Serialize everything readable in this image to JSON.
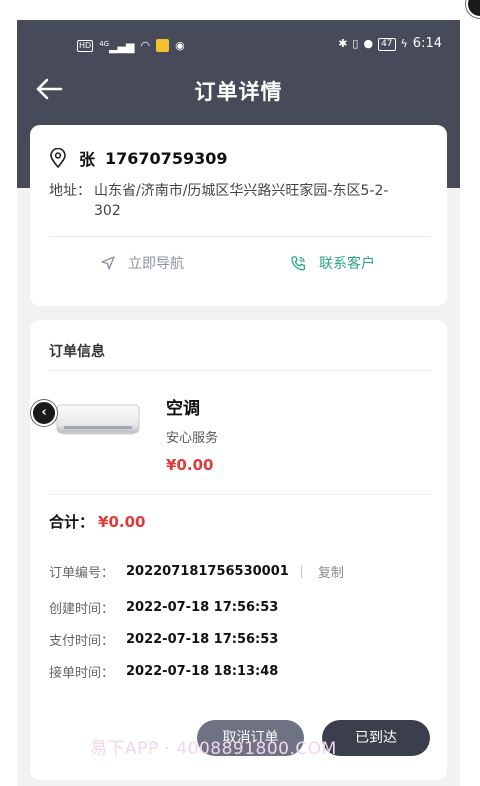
{
  "status_bar": {
    "left_icons": [
      "hd-icon",
      "signal-icon",
      "wifi-icon",
      "app-notification-icon",
      "location-share-icon"
    ],
    "hd_label": "HD",
    "network_label": "4G",
    "battery_level": "47",
    "time": "6:14"
  },
  "nav": {
    "title": "订单详情"
  },
  "address_card": {
    "contact_name": "张",
    "contact_phone": "17670759309",
    "address_label": "地址：",
    "address_text": "山东省/济南市/历城区华兴路兴旺家园-东区5-2-302",
    "navigate_label": "立即导航",
    "contact_label": "联系客户",
    "colors": {
      "navigate": "#8c93a6",
      "contact": "#2ea58b"
    }
  },
  "order_card": {
    "section_title": "订单信息",
    "product": {
      "name": "空调",
      "service": "安心服务",
      "price": "¥0.00"
    },
    "total_label": "合计：",
    "total_value": "¥0.00",
    "rows": [
      {
        "label": "订单编号：",
        "value": "202207181756530001"
      },
      {
        "label": "创建时间：",
        "value": "2022-07-18 17:56:53"
      },
      {
        "label": "支付时间：",
        "value": "2022-07-18 17:56:53"
      },
      {
        "label": "接单时间：",
        "value": "2022-07-18 18:13:48"
      }
    ],
    "copy_label": "复制"
  },
  "buttons": {
    "cancel_label": "取消订单",
    "arrived_label": "已到达"
  },
  "watermark": "易下APP · 4008891800.COM",
  "colors": {
    "header": "#474a58",
    "price_red": "#e23a3a",
    "primary_button": "#3b3e4c",
    "secondary_button": "#6e7282"
  }
}
